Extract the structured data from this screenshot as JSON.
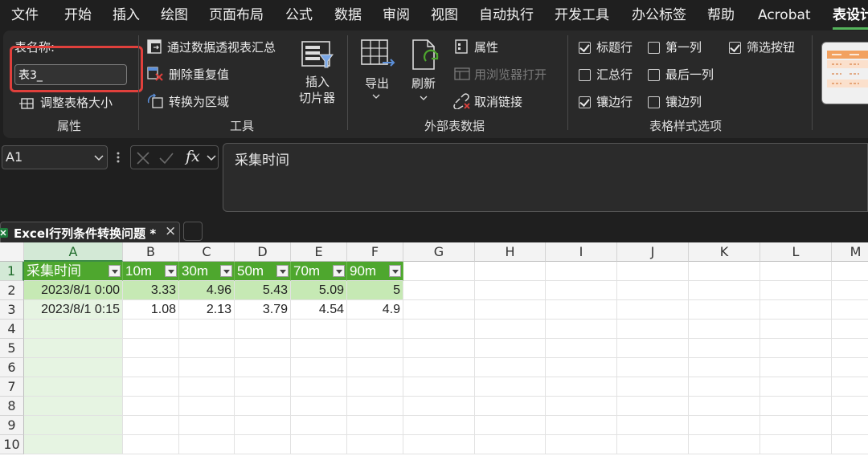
{
  "menu": {
    "items": [
      "文件",
      "开始",
      "插入",
      "绘图",
      "页面布局",
      "公式",
      "数据",
      "审阅",
      "视图",
      "自动执行",
      "开发工具",
      "办公标签",
      "帮助",
      "Acrobat",
      "表设计"
    ],
    "active_index": 14
  },
  "ribbon": {
    "properties": {
      "table_name_label": "表名称:",
      "table_name_value": "表3_",
      "resize_label": "调整表格大小",
      "group_label": "属性"
    },
    "tools": {
      "pivot_label": "通过数据透视表汇总",
      "remove_dup_label": "删除重复值",
      "convert_label": "转换为区域",
      "slicer_label_1": "插入",
      "slicer_label_2": "切片器",
      "group_label": "工具"
    },
    "external": {
      "export_label": "导出",
      "refresh_label": "刷新",
      "properties_label": "属性",
      "open_browser_label": "用浏览器打开",
      "unlink_label": "取消链接",
      "group_label": "外部表数据"
    },
    "style_options": {
      "header_row": "标题行",
      "first_col": "第一列",
      "filter_btn": "筛选按钮",
      "total_row": "汇总行",
      "last_col": "最后一列",
      "banded_rows": "镶边行",
      "banded_cols": "镶边列",
      "group_label": "表格样式选项",
      "checked": {
        "header_row": true,
        "first_col": false,
        "filter_btn": true,
        "total_row": false,
        "last_col": false,
        "banded_rows": true,
        "banded_cols": false
      }
    }
  },
  "formula_bar": {
    "name_box": "A1",
    "fx": "fx",
    "formula": "采集时间"
  },
  "sheet_tab": {
    "title": "Excel行列条件转换问题 *",
    "close": "×"
  },
  "grid": {
    "columns": [
      "A",
      "B",
      "C",
      "D",
      "E",
      "F",
      "G",
      "H",
      "I",
      "J",
      "K",
      "L",
      "M"
    ],
    "rows": [
      "1",
      "2",
      "3",
      "4",
      "5",
      "6",
      "7",
      "8",
      "9",
      "10"
    ],
    "headers": [
      "采集时间",
      "10m",
      "30m",
      "50m",
      "70m",
      "90m"
    ],
    "data": [
      [
        "2023/8/1 0:00",
        "3.33",
        "4.96",
        "5.43",
        "5.09",
        "5"
      ],
      [
        "2023/8/1 0:15",
        "1.08",
        "2.13",
        "3.79",
        "4.54",
        "4.9"
      ]
    ]
  }
}
